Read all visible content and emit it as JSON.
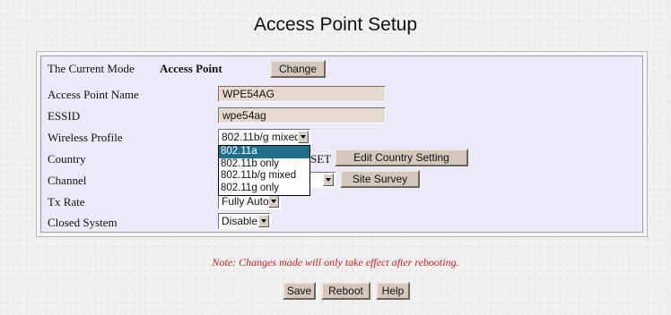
{
  "page": {
    "title": "Access Point Setup"
  },
  "form": {
    "current_mode_label": "The Current Mode",
    "current_mode_value": "Access Point",
    "change_button": "Change",
    "ap_name_label": "Access Point Name",
    "ap_name_value": "WPE54AG",
    "essid_label": "ESSID",
    "essid_value": "wpe54ag",
    "wireless_profile_label": "Wireless Profile",
    "wireless_profile_value": "802.11b/g mixed",
    "wireless_profile_options": [
      "802.11a",
      "802.11b only",
      "802.11b/g mixed",
      "802.11g only"
    ],
    "wireless_profile_highlighted": "802.11a",
    "country_label": "Country",
    "country_value_partial": "SET",
    "edit_country_button": "Edit Country Setting",
    "channel_label": "Channel",
    "site_survey_button": "Site Survey",
    "tx_rate_label": "Tx Rate",
    "tx_rate_value": "Fully Auto",
    "closed_system_label": "Closed System",
    "closed_system_value": "Disable"
  },
  "footer": {
    "note": "Note: Changes made will only take effect after rebooting.",
    "save_button": "Save",
    "reboot_button": "Reboot",
    "help_button": "Help"
  },
  "colors": {
    "panel_bg": "#eaeaf8",
    "button_bg": "#d4c8bc",
    "field_bg": "#e6dad0",
    "note_text": "#c81e1e",
    "dropdown_highlight": "#1f6f8b"
  }
}
